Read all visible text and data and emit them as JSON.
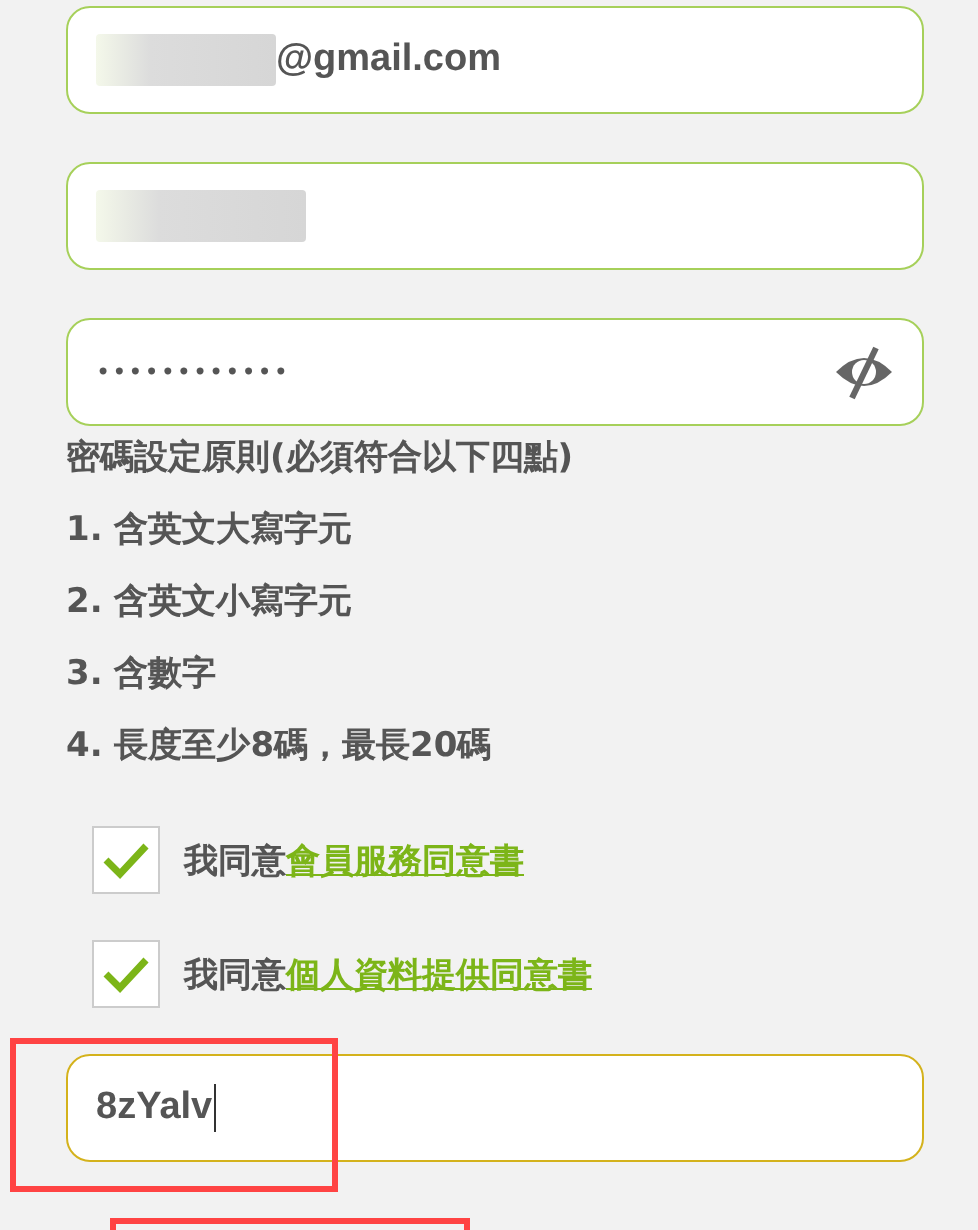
{
  "fields": [
    {
      "kind": "email",
      "value": "@gmail.com",
      "masked": true
    },
    {
      "kind": "text",
      "masked": true
    },
    {
      "kind": "password",
      "value": "••••••••••••",
      "reveal_icon": true
    }
  ],
  "password_rules": {
    "title": "密碼設定原則(必須符合以下四點)",
    "items": [
      "1. 含英文大寫字元",
      "2. 含英文小寫字元",
      "3. 含數字",
      "4. 長度至少8碼，最長20碼"
    ]
  },
  "agreements": [
    {
      "text": "我同意",
      "link": "會員服務同意書",
      "checked": true
    },
    {
      "text": "我同意",
      "link": "個人資料提供同意書",
      "checked": true
    }
  ],
  "captcha": {
    "value": "8zYalv",
    "focused": true
  },
  "annotations": [
    {
      "kind": "highlight"
    },
    {
      "kind": "highlight"
    }
  ]
}
